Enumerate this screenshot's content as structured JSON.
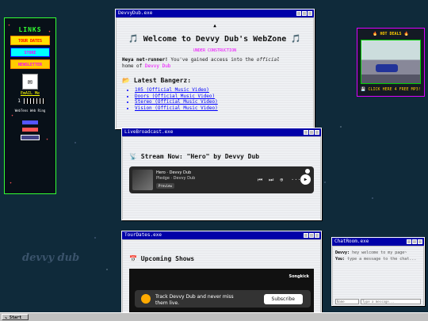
{
  "links": {
    "title": "LINKS",
    "buttons": [
      "TOUR DATES",
      "STORE",
      "NEWSLETTER"
    ],
    "email_label": "EmAIL Me",
    "visit_count": "1",
    "webring_text": "WebTens Web Ring"
  },
  "main_window": {
    "title": "DevvyDub.exe",
    "heading": "🎵 Welcome to Devvy Dub's WebZone 🎵",
    "construction": "UNDER CONSTRUCTION",
    "intro_bold": "Heya net-runner!",
    "intro_text": " You've gained access into the ",
    "intro_official": "official",
    "intro_home": "home of ",
    "intro_name": "Devvy Dub",
    "bangers_heading": "📂 Latest Bangerz:",
    "bangers": [
      "105 (Official Music Video)",
      "Doors (Official Music Video)",
      "Stereo (Official Music Video)",
      "Vision (Official Music Video)"
    ]
  },
  "live_window": {
    "title": "LiveBroadcast.exe",
    "heading": "📡 Stream Now: \"Hero\" by Devvy Dub",
    "track": "Hero · Devvy Dub",
    "subtitle": "Pledge · Devvy Dub",
    "preview": "Preview"
  },
  "tour_window": {
    "title": "TourDates.exe",
    "heading": "📅 Upcoming Shows",
    "brand": "Songkick",
    "track_text": "Track Devvy Dub and never miss them live.",
    "subscribe": "Subscribe"
  },
  "deals": {
    "heading": "🔥 HOT DEALS 🔥",
    "cta": "💾 CLICK HERE 4 FREE MP3!"
  },
  "chat_window": {
    "title": "ChatRoom.exe",
    "messages": [
      {
        "user": "Devvy:",
        "text": " hey welcome to my page~"
      },
      {
        "user": "You:",
        "text": " type a message to the chat..."
      }
    ],
    "name_placeholder": "Name",
    "message_placeholder": "Type a message..."
  },
  "watermark": "devvy dub",
  "taskbar": {
    "start": "Start"
  }
}
